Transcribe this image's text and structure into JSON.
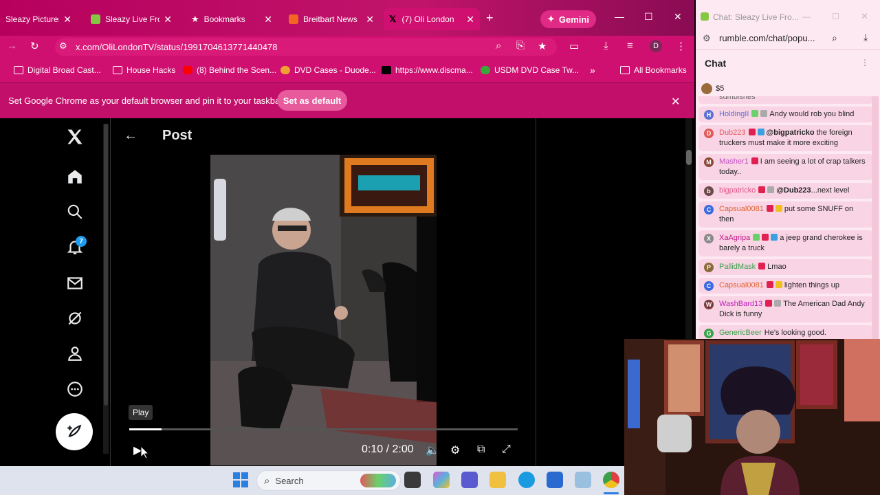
{
  "tabs": [
    {
      "title": "Sleazy Pictures",
      "favicon": "sleazy-icon",
      "color": "#c9cce5"
    },
    {
      "title": "Sleazy Live From",
      "favicon": "rumble-icon",
      "color": "#85c742"
    },
    {
      "title": "Bookmarks",
      "favicon": "star-icon",
      "color": "#ffffff"
    },
    {
      "title": "Breitbart News",
      "favicon": "breitbart-icon",
      "color": "#f26522"
    },
    {
      "title": "(7) Oli London",
      "favicon": "x-logo-icon",
      "color": "#000000"
    }
  ],
  "gemini_label": "Gemini",
  "url": "x.com/OliLondonTV/status/1991704613771440478",
  "bookmarks": [
    "Digital Broad Cast...",
    "House Hacks",
    "(8) Behind the Scen...",
    "DVD Cases - Duode...",
    "https://www.discma...",
    "USDM DVD Case Tw...",
    "All Bookmarks"
  ],
  "infobar": {
    "text": "Set Google Chrome as your default browser and pin it to your taskbar",
    "button": "Set as default"
  },
  "post": {
    "title": "Post",
    "notification_count": "7"
  },
  "video": {
    "tooltip": "Play",
    "time": "0:10 / 2:00",
    "progress": 0.083
  },
  "chat": {
    "window_title": "Chat: Sleazy Live Fro...",
    "url": "rumble.com/chat/popu...",
    "header": "Chat",
    "rant": "$5",
    "messages": [
      {
        "user": "",
        "text": "sumbishes",
        "initial": "",
        "color": "#e04d8f"
      },
      {
        "user": "HoldingII",
        "text": "Andy would rob you blind",
        "initial": "H",
        "color": "#5b6fd6"
      },
      {
        "user": "Dub223",
        "mention": "@bigpatricko",
        "text": "the foreign truckers must make it more exciting",
        "initial": "D",
        "color": "#e05a5a"
      },
      {
        "user": "Masher1",
        "text": "I am seeing a lot of crap talkers today..",
        "initial": "M",
        "color": "#c04fc0"
      },
      {
        "user": "bigpatricko",
        "mention": "@Dub223",
        "text": "...next level",
        "initial": "b",
        "color": "#e05a8a"
      },
      {
        "user": "Capsual0081",
        "text": "put some SNUFF on then",
        "initial": "C",
        "color": "#e2632f"
      },
      {
        "user": "XaAgripa",
        "text": "a jeep grand cherokee is barely a truck",
        "initial": "X",
        "color": "#c0158a"
      },
      {
        "user": "PallidMask",
        "text": "Lmao",
        "initial": "P",
        "color": "#8a6a3a"
      },
      {
        "user": "Capsual0081",
        "text": "lighten things up",
        "initial": "C",
        "color": "#e2632f"
      },
      {
        "user": "WashBard13",
        "text": "The American Dad Andy Dick is funny",
        "initial": "W",
        "color": "#a03a7a"
      },
      {
        "user": "GenericBeer",
        "text": "He's looking good.",
        "initial": "G",
        "color": "#3aa04a"
      }
    ]
  },
  "taskbar": {
    "search_placeholder": "Search"
  }
}
